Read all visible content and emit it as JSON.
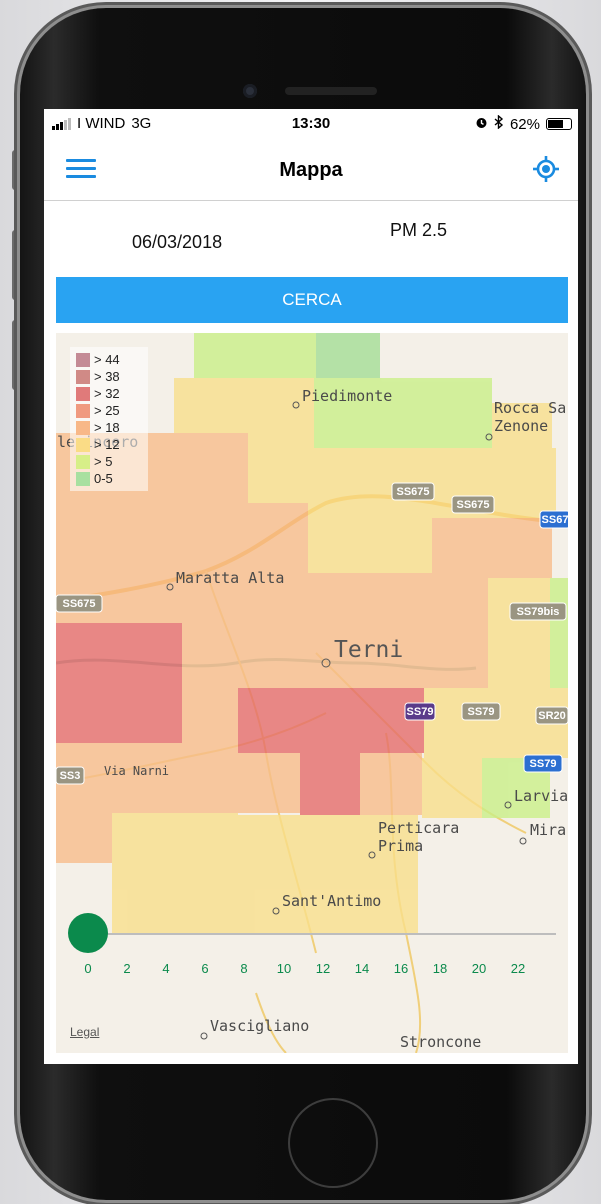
{
  "status_bar": {
    "carrier": "I WIND",
    "network": "3G",
    "time": "13:30",
    "battery": "62%",
    "alarm_icon": "alarm-icon",
    "bluetooth_icon": "bluetooth-icon"
  },
  "navbar": {
    "title": "Mappa",
    "menu_icon": "hamburger-menu-icon",
    "locate_icon": "location-target-icon",
    "accent_color": "#1a8be0"
  },
  "filters": {
    "date": "06/03/2018",
    "pollutant": "PM 2.5"
  },
  "search_button": {
    "label": "CERCA",
    "color": "#29a3f2"
  },
  "legend": {
    "items": [
      {
        "label": "> 44",
        "color": "#c48b96"
      },
      {
        "label": "> 38",
        "color": "#d08a86"
      },
      {
        "label": "> 32",
        "color": "#e07a7a"
      },
      {
        "label": "> 25",
        "color": "#f09a80"
      },
      {
        "label": "> 18",
        "color": "#f8b888"
      },
      {
        "label": "> 12",
        "color": "#fadc86"
      },
      {
        "label": "> 5",
        "color": "#d7ef88"
      },
      {
        "label": "0-5",
        "color": "#a8e0a0"
      }
    ]
  },
  "map": {
    "places": [
      "Piedimonte",
      "Rocca Sa",
      "Zenone",
      "llerincero",
      "Maratta Alta",
      "Terni",
      "Via Narni",
      "Perticara",
      "Prima",
      "Sant'Antimo",
      "Larvia",
      "Mira",
      "Vascigliano",
      "Stroncone"
    ],
    "roads": [
      "SS675",
      "SS675",
      "SS67",
      "SS675",
      "SS79bis",
      "SS79",
      "SS79",
      "SR20",
      "SS79",
      "SS3"
    ],
    "legal": "Legal"
  },
  "time_slider": {
    "value": 0,
    "ticks": [
      "0",
      "2",
      "4",
      "6",
      "8",
      "10",
      "12",
      "14",
      "16",
      "18",
      "20",
      "22"
    ],
    "color": "#0b8a4c"
  }
}
